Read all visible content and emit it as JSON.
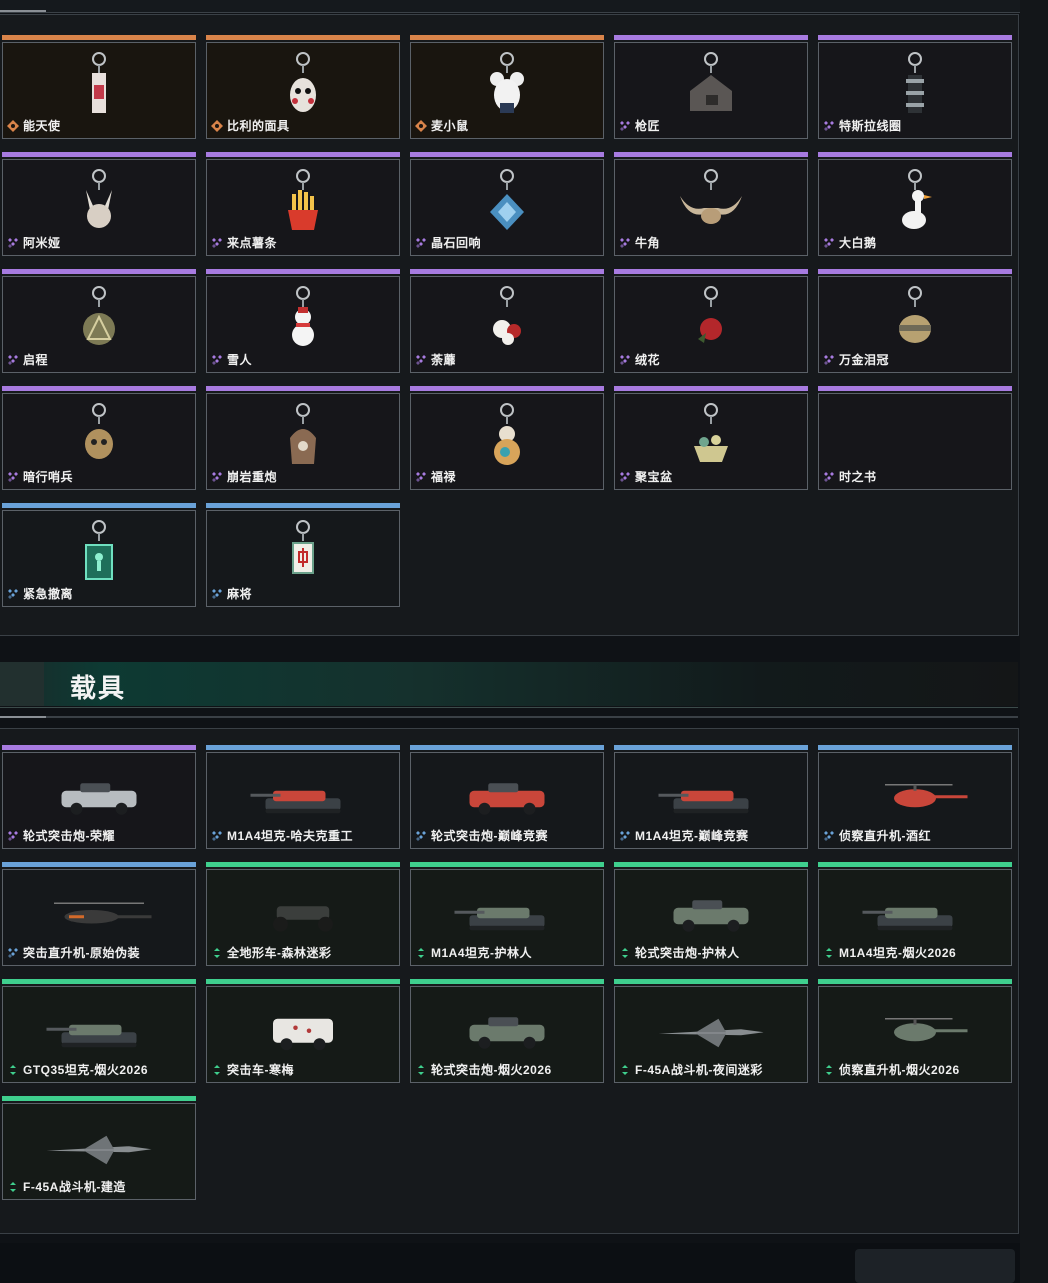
{
  "colors": {
    "orange": "#d9844a",
    "purple": "#a77be0",
    "blue": "#6aa2d8",
    "green": "#3fcf8e"
  },
  "section_vehicles": {
    "title": "载具"
  },
  "charms": [
    {
      "name": "能天使",
      "rarity": "orange",
      "icon": "bottle-charm-icon"
    },
    {
      "name": "比利的面具",
      "rarity": "orange",
      "icon": "mask-charm-icon"
    },
    {
      "name": "麦小鼠",
      "rarity": "orange",
      "icon": "mouse-charm-icon"
    },
    {
      "name": "枪匠",
      "rarity": "purple",
      "icon": "house-charm-icon"
    },
    {
      "name": "特斯拉线圈",
      "rarity": "purple",
      "icon": "coil-charm-icon"
    },
    {
      "name": "阿米娅",
      "rarity": "purple",
      "icon": "bunny-charm-icon"
    },
    {
      "name": "来点薯条",
      "rarity": "purple",
      "icon": "fries-charm-icon"
    },
    {
      "name": "晶石回响",
      "rarity": "purple",
      "icon": "crystal-charm-icon"
    },
    {
      "name": "牛角",
      "rarity": "purple",
      "icon": "horns-charm-icon"
    },
    {
      "name": "大白鹅",
      "rarity": "purple",
      "icon": "goose-charm-icon"
    },
    {
      "name": "启程",
      "rarity": "purple",
      "icon": "medal-charm-icon"
    },
    {
      "name": "雪人",
      "rarity": "purple",
      "icon": "snowman-charm-icon"
    },
    {
      "name": "荼蘼",
      "rarity": "purple",
      "icon": "flower-charm-icon"
    },
    {
      "name": "绒花",
      "rarity": "purple",
      "icon": "rose-charm-icon"
    },
    {
      "name": "万金泪冠",
      "rarity": "purple",
      "icon": "crown-charm-icon"
    },
    {
      "name": "暗行哨兵",
      "rarity": "purple",
      "icon": "skull-charm-icon"
    },
    {
      "name": "崩岩重炮",
      "rarity": "purple",
      "icon": "hooded-charm-icon"
    },
    {
      "name": "福禄",
      "rarity": "purple",
      "icon": "gourd-charm-icon"
    },
    {
      "name": "聚宝盆",
      "rarity": "purple",
      "icon": "treasure-bowl-charm-icon"
    },
    {
      "name": "时之书",
      "rarity": "purple",
      "icon": ""
    },
    {
      "name": "紧急撤离",
      "rarity": "blue",
      "icon": "exit-sign-charm-icon"
    },
    {
      "name": "麻将",
      "rarity": "blue",
      "icon": "mahjong-charm-icon"
    }
  ],
  "vehicles": [
    {
      "name": "轮式突击炮-荣耀",
      "rarity": "purple",
      "icon": "armored-car-icon"
    },
    {
      "name": "M1A4坦克-哈夫克重工",
      "rarity": "blue",
      "icon": "tank-icon"
    },
    {
      "name": "轮式突击炮-巅峰竞赛",
      "rarity": "blue",
      "icon": "armored-car-icon"
    },
    {
      "name": "M1A4坦克-巅峰竞赛",
      "rarity": "blue",
      "icon": "tank-icon"
    },
    {
      "name": "侦察直升机-酒红",
      "rarity": "blue",
      "icon": "helicopter-icon"
    },
    {
      "name": "突击直升机-原始伪装",
      "rarity": "blue",
      "icon": "attack-helicopter-icon"
    },
    {
      "name": "全地形车-森林迷彩",
      "rarity": "green",
      "icon": "atv-icon"
    },
    {
      "name": "M1A4坦克-护林人",
      "rarity": "green",
      "icon": "tank-icon"
    },
    {
      "name": "轮式突击炮-护林人",
      "rarity": "green",
      "icon": "armored-car-icon"
    },
    {
      "name": "M1A4坦克-烟火2026",
      "rarity": "green",
      "icon": "tank-icon"
    },
    {
      "name": "GTQ35坦克-烟火2026",
      "rarity": "green",
      "icon": "tank-icon"
    },
    {
      "name": "突击车-寒梅",
      "rarity": "green",
      "icon": "assault-vehicle-icon"
    },
    {
      "name": "轮式突击炮-烟火2026",
      "rarity": "green",
      "icon": "armored-car-icon"
    },
    {
      "name": "F-45A战斗机-夜间迷彩",
      "rarity": "green",
      "icon": "fighter-jet-icon"
    },
    {
      "name": "侦察直升机-烟火2026",
      "rarity": "green",
      "icon": "helicopter-icon"
    },
    {
      "name": "F-45A战斗机-建造",
      "rarity": "green",
      "icon": "fighter-jet-icon"
    }
  ]
}
